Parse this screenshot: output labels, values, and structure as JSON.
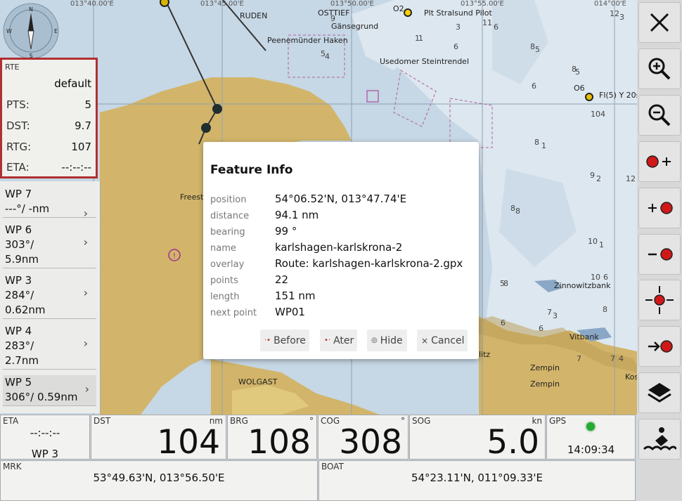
{
  "map": {
    "grid_labels": [
      "013°40.00'E",
      "013°45.00'E",
      "013°50.00'E",
      "013°55.00'E",
      "014°00'E"
    ],
    "places": [
      "RUDEN",
      "OSTTIEF",
      "Gänsegrund",
      "Plt Stralsund Pilot",
      "Peenemünder Haken",
      "Usedomer Steintrendel",
      "Freest",
      "WOLGAST",
      "Zinnowitzbank",
      "Vitbank",
      "Zempin",
      "Zempin",
      "litz",
      "Kos",
      "Fl(5) Y 20s",
      "O2",
      "O6"
    ],
    "depths": [
      "9",
      "3",
      "6",
      "1",
      "11",
      "6",
      "12",
      "3",
      "5",
      "8",
      "5",
      "8",
      "6",
      "10",
      "4",
      "1",
      "8",
      "9",
      "2",
      "12",
      "8",
      "8",
      "10",
      "1",
      "10",
      "6",
      "5",
      "8",
      "7",
      "3",
      "6",
      "6",
      "8",
      "4",
      "7",
      "7",
      "5",
      "4",
      "1"
    ]
  },
  "route": {
    "header": "RTE",
    "name": "default",
    "rows": [
      {
        "label": "PTS:",
        "value": "5"
      },
      {
        "label": "DST:",
        "value": "9.7"
      },
      {
        "label": "RTG:",
        "value": "107"
      },
      {
        "label": "ETA:",
        "value": "--:--:--"
      }
    ]
  },
  "waypoints": [
    {
      "name": "WP 7",
      "line2": "---°/ -nm"
    },
    {
      "name": "WP 6",
      "line2": "303°/",
      "line3": "5.9nm"
    },
    {
      "name": "WP 3",
      "line2": "284°/",
      "line3": "0.62nm"
    },
    {
      "name": "WP 4",
      "line2": "283°/",
      "line3": "2.7nm"
    },
    {
      "name": "WP 5",
      "line2": "306°/ 0.59nm"
    }
  ],
  "dialog": {
    "title": "Feature Info",
    "fields": [
      {
        "key": "position",
        "value": "54°06.52'N, 013°47.74'E"
      },
      {
        "key": "distance",
        "value": "94.1 nm"
      },
      {
        "key": "bearing",
        "value": "99 °"
      },
      {
        "key": "name",
        "value": "karlshagen-karlskrona-2"
      },
      {
        "key": "overlay",
        "value": "Route: karlshagen-karlskrona-2.gpx"
      },
      {
        "key": "points",
        "value": "22"
      },
      {
        "key": "length",
        "value": "151 nm"
      },
      {
        "key": "next point",
        "value": "WP01"
      }
    ],
    "buttons": {
      "before": "Before",
      "after": "Ater",
      "hide": "Hide",
      "cancel": "Cancel"
    }
  },
  "bottom": {
    "eta": {
      "label": "ETA",
      "time": "--:--:--",
      "wp": "WP 3"
    },
    "dst": {
      "label": "DST",
      "unit": "nm",
      "value": "104"
    },
    "brg": {
      "label": "BRG",
      "unit": "°",
      "value": "108"
    },
    "cog": {
      "label": "COG",
      "unit": "°",
      "value": "308"
    },
    "sog": {
      "label": "SOG",
      "unit": "kn",
      "value": "5.0"
    },
    "gps": {
      "label": "GPS",
      "time": "14:09:34",
      "status_color": "#22aa33"
    },
    "mrk": {
      "label": "MRK",
      "value": "53°49.63'N, 013°56.50'E"
    },
    "boat": {
      "label": "BOAT",
      "value": "54°23.11'N, 011°09.33'E"
    }
  },
  "toolbar": [
    "close-icon",
    "zoom-in-icon",
    "zoom-out-icon",
    "add-waypoint-after-icon",
    "add-waypoint-before-icon",
    "delete-waypoint-icon",
    "center-target-icon",
    "go-to-waypoint-icon",
    "layers-icon",
    "anchor-watch-icon"
  ],
  "colors": {
    "land": "#d2b56a",
    "shallow": "#a9c6df",
    "deep": "#dde7ef",
    "route": "#333333",
    "rte_border": "#b03030"
  }
}
